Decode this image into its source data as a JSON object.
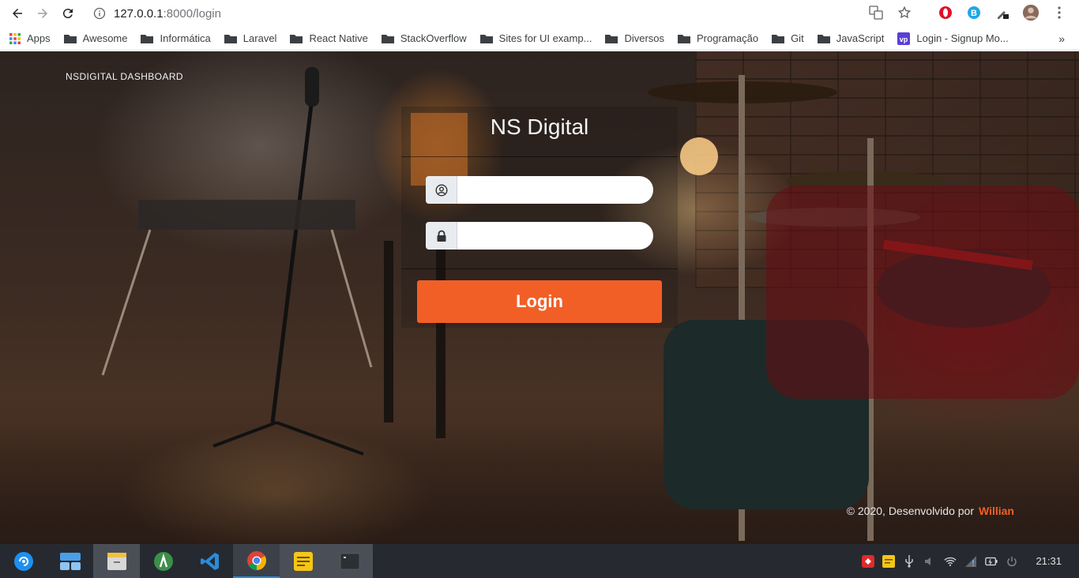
{
  "browser": {
    "url_host": "127.0.0.1",
    "url_path": ":8000/login",
    "bookmarks": [
      {
        "label": "Apps"
      },
      {
        "label": "Awesome"
      },
      {
        "label": "Informática"
      },
      {
        "label": "Laravel"
      },
      {
        "label": "React Native"
      },
      {
        "label": "StackOverflow"
      },
      {
        "label": "Sites for UI examp..."
      },
      {
        "label": "Diversos"
      },
      {
        "label": "Programação"
      },
      {
        "label": "Git"
      },
      {
        "label": "JavaScript"
      },
      {
        "label": "Login - Signup Mo..."
      }
    ],
    "bookmarks_more": "»"
  },
  "page": {
    "brand": "NSDIGITAL DASHBOARD",
    "title": "NS Digital",
    "username_value": "",
    "password_value": "",
    "login_button": "Login",
    "footer_text": "© 2020, Desenvolvido por",
    "footer_author": "Willian"
  },
  "taskbar": {
    "clock": "21:31"
  },
  "colors": {
    "accent": "#f25f26",
    "taskbar": "#262a30"
  }
}
